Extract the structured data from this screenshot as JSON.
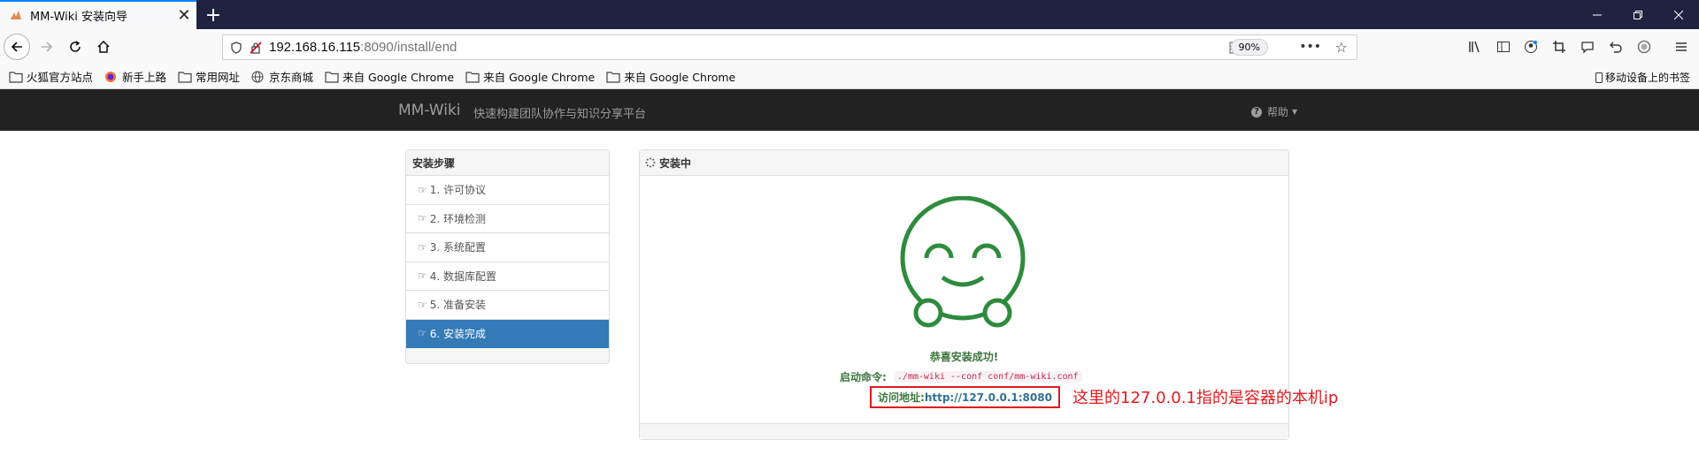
{
  "browser": {
    "tab_title": "MM-Wiki 安装向导",
    "new_tab_label": "+",
    "url_host": "192.168.16.115",
    "url_rest": ":8090/install/end",
    "zoom": "90%"
  },
  "bookmarks": [
    {
      "label": "火狐官方站点",
      "icon": "folder-icon"
    },
    {
      "label": "新手上路",
      "icon": "firefox-icon"
    },
    {
      "label": "常用网址",
      "icon": "folder-icon"
    },
    {
      "label": "京东商城",
      "icon": "globe-icon"
    },
    {
      "label": "来自 Google Chrome",
      "icon": "folder-icon"
    },
    {
      "label": "来自 Google Chrome",
      "icon": "folder-icon"
    },
    {
      "label": "来自 Google Chrome",
      "icon": "folder-icon"
    }
  ],
  "mobile_bookmarks": "移动设备上的书签",
  "app": {
    "brand": "MM-Wiki",
    "slogan": "快速构建团队协作与知识分享平台",
    "help": "帮助"
  },
  "steps_panel": {
    "title": "安装步骤",
    "steps": [
      {
        "label": "1. 许可协议",
        "active": false
      },
      {
        "label": "2. 环境检测",
        "active": false
      },
      {
        "label": "3. 系统配置",
        "active": false
      },
      {
        "label": "4. 数据库配置",
        "active": false
      },
      {
        "label": "5. 准备安装",
        "active": false
      },
      {
        "label": "6. 安装完成",
        "active": true
      }
    ]
  },
  "main_panel": {
    "title": "安装中",
    "success_message": "恭喜安装成功!",
    "command_label": "启动命令:",
    "command": "./mm-wiki --conf conf/mm-wiki.conf",
    "address_label": "访问地址:",
    "address": "http://127.0.0.1:8080"
  },
  "annotation": "这里的127.0.0.1指的是容器的本机ip",
  "colors": {
    "accent": "#337ab7",
    "success_green": "#3c763d",
    "smiley_green": "#2e8b3e",
    "annotation_red": "#e0191f",
    "navbar_dark": "#222222"
  }
}
